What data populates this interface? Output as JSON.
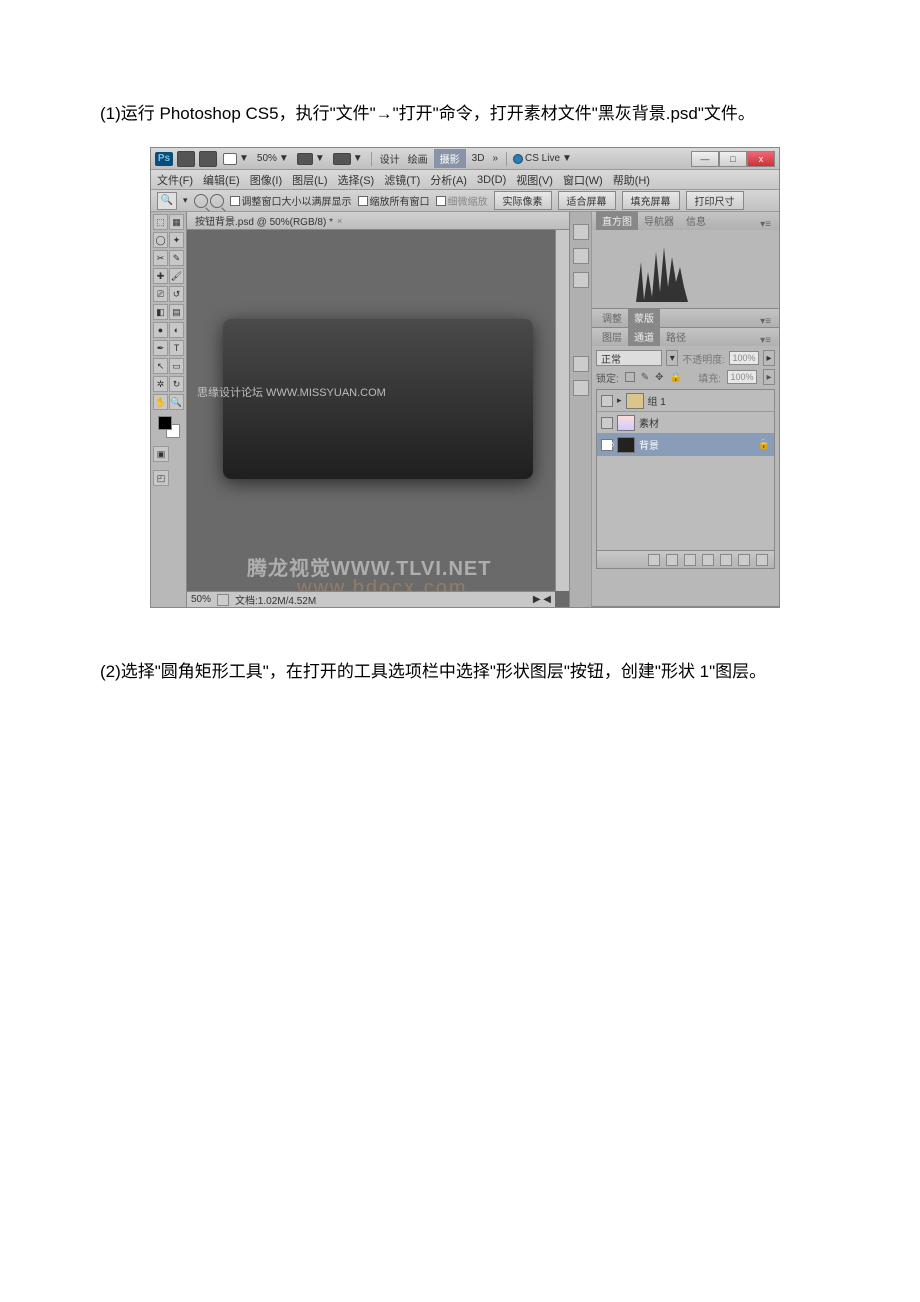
{
  "doc": {
    "step1": "(1)运行 Photoshop CS5，执行\"文件\"→\"打开\"命令，打开素材文件\"黑灰背景.psd\"文件。",
    "step2": "(2)选择\"圆角矩形工具\"，在打开的工具选项栏中选择\"形状图层\"按钮，创建\"形状 1\"图层。"
  },
  "appbar": {
    "zoom_pct": "50%",
    "menus": [
      "设计",
      "绘画",
      "摄影",
      "3D",
      "»"
    ],
    "cslive": "CS Live",
    "win_min": "—",
    "win_max": "□",
    "win_close": "x"
  },
  "menubar": {
    "items": [
      "文件(F)",
      "编辑(E)",
      "图像(I)",
      "图层(L)",
      "选择(S)",
      "滤镜(T)",
      "分析(A)",
      "3D(D)",
      "视图(V)",
      "窗口(W)",
      "帮助(H)"
    ]
  },
  "options": {
    "check1": "调整窗口大小以满屏显示",
    "check2": "缩放所有窗口",
    "check3": "细微缩放",
    "btn_actual": "实际像素",
    "btn_fit": "适合屏幕",
    "btn_fill": "填充屏幕",
    "btn_print": "打印尺寸"
  },
  "doc_tab": {
    "title": "按钮背景.psd @ 50%(RGB/8) *",
    "close": "×"
  },
  "statusbar": {
    "zoom": "50%",
    "docinfo": "文档:1.02M/4.52M"
  },
  "watermarks": {
    "wm1": "思缘设计论坛  WWW.MISSYUAN.COM",
    "wm2": "腾龙视觉WWW.TLVI.NET",
    "wm3": "www.bdocx.com"
  },
  "panels": {
    "histogram": {
      "tabs": [
        "直方图",
        "导航器",
        "信息"
      ]
    },
    "adjust": {
      "tabs": [
        "调整",
        "蒙版"
      ]
    },
    "layers": {
      "tabs": [
        "图层",
        "通道",
        "路径"
      ],
      "blend_mode": "正常",
      "opacity_label": "不透明度:",
      "opacity_value": "100%",
      "lock_label": "锁定:",
      "fill_label": "填充:",
      "fill_value": "100%",
      "items": [
        {
          "name": "组 1",
          "type": "group"
        },
        {
          "name": "素材",
          "type": "layer"
        },
        {
          "name": "背景",
          "type": "bg",
          "locked": true
        }
      ]
    }
  }
}
